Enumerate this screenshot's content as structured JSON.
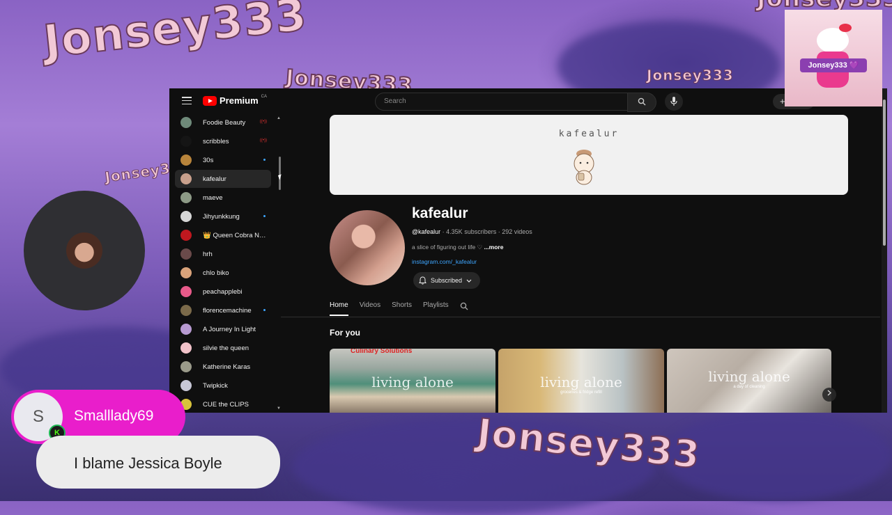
{
  "watermarks": [
    "Jonsey333",
    "Jonsey333",
    "Jonsey333",
    "Jonsey333",
    "Jonsey333",
    "Jonsey333",
    "Jonsey333"
  ],
  "youtube": {
    "logo_text": "Premium",
    "region": "CA",
    "search_placeholder": "Search",
    "create_label": "+",
    "sidebar": [
      {
        "name": "Foodie Beauty",
        "color": "#6f8a7a",
        "marker": "live"
      },
      {
        "name": "scribbles",
        "color": "#151515",
        "marker": "live"
      },
      {
        "name": "30s",
        "color": "#b8843b",
        "marker": "dot"
      },
      {
        "name": "kafealur",
        "color": "#c9a08c",
        "marker": "",
        "active": true
      },
      {
        "name": "maeve",
        "color": "#8d9a86",
        "marker": ""
      },
      {
        "name": "Jihyunkkung",
        "color": "#d6d6d6",
        "marker": "dot"
      },
      {
        "name": "👑 Queen Cobra NA...",
        "color": "#c0181f",
        "marker": ""
      },
      {
        "name": "hrh",
        "color": "#6a4a4a",
        "marker": ""
      },
      {
        "name": "chlo biko",
        "color": "#d9a27a",
        "marker": ""
      },
      {
        "name": "peachapplebi",
        "color": "#e85a8a",
        "marker": ""
      },
      {
        "name": "florencemachine",
        "color": "#7b6a4a",
        "marker": "dot"
      },
      {
        "name": "A Journey In Light",
        "color": "#b79ad1",
        "marker": ""
      },
      {
        "name": "silvie the queen",
        "color": "#f1c2c9",
        "marker": ""
      },
      {
        "name": "Katherine Karas",
        "color": "#9a9a8a",
        "marker": ""
      },
      {
        "name": "Twipkick",
        "color": "#c7c7d7",
        "marker": ""
      },
      {
        "name": "CUE the CLIPS",
        "color": "#d8c23b",
        "marker": ""
      }
    ],
    "banner_name": "kafealur",
    "channel": {
      "title": "kafealur",
      "handle": "@kafealur",
      "stats": "· 4.35K subscribers · 292 videos",
      "description": "a slice of figuring out life ♡",
      "more": "...more",
      "link": "instagram.com/_kafealur",
      "subscribed_label": "Subscribed"
    },
    "tabs": [
      "Home",
      "Videos",
      "Shorts",
      "Playlists"
    ],
    "section_title": "For you",
    "thumbnails": [
      {
        "label": "living alone",
        "caption": "",
        "sign": "Culinary Solutions"
      },
      {
        "label": "living alone",
        "caption": "groceries & fridge refill",
        "sign": ""
      },
      {
        "label": "living alone",
        "caption": "a day of cleaning",
        "sign": ""
      }
    ]
  },
  "overlay": {
    "badge_text": "Jonsey333 💜",
    "chat": {
      "avatar_letter": "S",
      "badge_letter": "K",
      "username": "Smalllady69",
      "message": "I blame Jessica Boyle"
    }
  }
}
